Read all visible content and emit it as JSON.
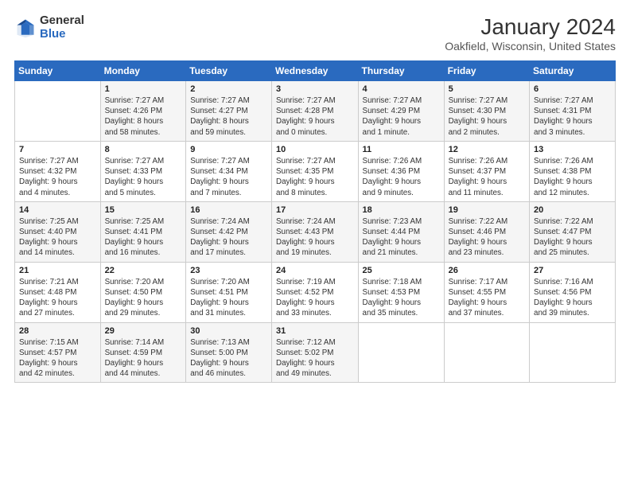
{
  "logo": {
    "general": "General",
    "blue": "Blue"
  },
  "header": {
    "title": "January 2024",
    "subtitle": "Oakfield, Wisconsin, United States"
  },
  "weekdays": [
    "Sunday",
    "Monday",
    "Tuesday",
    "Wednesday",
    "Thursday",
    "Friday",
    "Saturday"
  ],
  "weeks": [
    [
      {
        "day": "",
        "info": ""
      },
      {
        "day": "1",
        "info": "Sunrise: 7:27 AM\nSunset: 4:26 PM\nDaylight: 8 hours\nand 58 minutes."
      },
      {
        "day": "2",
        "info": "Sunrise: 7:27 AM\nSunset: 4:27 PM\nDaylight: 8 hours\nand 59 minutes."
      },
      {
        "day": "3",
        "info": "Sunrise: 7:27 AM\nSunset: 4:28 PM\nDaylight: 9 hours\nand 0 minutes."
      },
      {
        "day": "4",
        "info": "Sunrise: 7:27 AM\nSunset: 4:29 PM\nDaylight: 9 hours\nand 1 minute."
      },
      {
        "day": "5",
        "info": "Sunrise: 7:27 AM\nSunset: 4:30 PM\nDaylight: 9 hours\nand 2 minutes."
      },
      {
        "day": "6",
        "info": "Sunrise: 7:27 AM\nSunset: 4:31 PM\nDaylight: 9 hours\nand 3 minutes."
      }
    ],
    [
      {
        "day": "7",
        "info": "Sunrise: 7:27 AM\nSunset: 4:32 PM\nDaylight: 9 hours\nand 4 minutes."
      },
      {
        "day": "8",
        "info": "Sunrise: 7:27 AM\nSunset: 4:33 PM\nDaylight: 9 hours\nand 5 minutes."
      },
      {
        "day": "9",
        "info": "Sunrise: 7:27 AM\nSunset: 4:34 PM\nDaylight: 9 hours\nand 7 minutes."
      },
      {
        "day": "10",
        "info": "Sunrise: 7:27 AM\nSunset: 4:35 PM\nDaylight: 9 hours\nand 8 minutes."
      },
      {
        "day": "11",
        "info": "Sunrise: 7:26 AM\nSunset: 4:36 PM\nDaylight: 9 hours\nand 9 minutes."
      },
      {
        "day": "12",
        "info": "Sunrise: 7:26 AM\nSunset: 4:37 PM\nDaylight: 9 hours\nand 11 minutes."
      },
      {
        "day": "13",
        "info": "Sunrise: 7:26 AM\nSunset: 4:38 PM\nDaylight: 9 hours\nand 12 minutes."
      }
    ],
    [
      {
        "day": "14",
        "info": "Sunrise: 7:25 AM\nSunset: 4:40 PM\nDaylight: 9 hours\nand 14 minutes."
      },
      {
        "day": "15",
        "info": "Sunrise: 7:25 AM\nSunset: 4:41 PM\nDaylight: 9 hours\nand 16 minutes."
      },
      {
        "day": "16",
        "info": "Sunrise: 7:24 AM\nSunset: 4:42 PM\nDaylight: 9 hours\nand 17 minutes."
      },
      {
        "day": "17",
        "info": "Sunrise: 7:24 AM\nSunset: 4:43 PM\nDaylight: 9 hours\nand 19 minutes."
      },
      {
        "day": "18",
        "info": "Sunrise: 7:23 AM\nSunset: 4:44 PM\nDaylight: 9 hours\nand 21 minutes."
      },
      {
        "day": "19",
        "info": "Sunrise: 7:22 AM\nSunset: 4:46 PM\nDaylight: 9 hours\nand 23 minutes."
      },
      {
        "day": "20",
        "info": "Sunrise: 7:22 AM\nSunset: 4:47 PM\nDaylight: 9 hours\nand 25 minutes."
      }
    ],
    [
      {
        "day": "21",
        "info": "Sunrise: 7:21 AM\nSunset: 4:48 PM\nDaylight: 9 hours\nand 27 minutes."
      },
      {
        "day": "22",
        "info": "Sunrise: 7:20 AM\nSunset: 4:50 PM\nDaylight: 9 hours\nand 29 minutes."
      },
      {
        "day": "23",
        "info": "Sunrise: 7:20 AM\nSunset: 4:51 PM\nDaylight: 9 hours\nand 31 minutes."
      },
      {
        "day": "24",
        "info": "Sunrise: 7:19 AM\nSunset: 4:52 PM\nDaylight: 9 hours\nand 33 minutes."
      },
      {
        "day": "25",
        "info": "Sunrise: 7:18 AM\nSunset: 4:53 PM\nDaylight: 9 hours\nand 35 minutes."
      },
      {
        "day": "26",
        "info": "Sunrise: 7:17 AM\nSunset: 4:55 PM\nDaylight: 9 hours\nand 37 minutes."
      },
      {
        "day": "27",
        "info": "Sunrise: 7:16 AM\nSunset: 4:56 PM\nDaylight: 9 hours\nand 39 minutes."
      }
    ],
    [
      {
        "day": "28",
        "info": "Sunrise: 7:15 AM\nSunset: 4:57 PM\nDaylight: 9 hours\nand 42 minutes."
      },
      {
        "day": "29",
        "info": "Sunrise: 7:14 AM\nSunset: 4:59 PM\nDaylight: 9 hours\nand 44 minutes."
      },
      {
        "day": "30",
        "info": "Sunrise: 7:13 AM\nSunset: 5:00 PM\nDaylight: 9 hours\nand 46 minutes."
      },
      {
        "day": "31",
        "info": "Sunrise: 7:12 AM\nSunset: 5:02 PM\nDaylight: 9 hours\nand 49 minutes."
      },
      {
        "day": "",
        "info": ""
      },
      {
        "day": "",
        "info": ""
      },
      {
        "day": "",
        "info": ""
      }
    ]
  ]
}
